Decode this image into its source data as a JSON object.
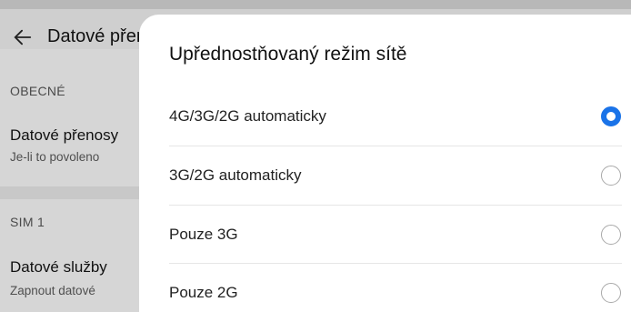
{
  "background": {
    "title": "Datové přenosy",
    "sections": [
      {
        "header": "OBECNÉ",
        "item_title": "Datové přenosy",
        "item_subtitle": "Je-li to povoleno"
      },
      {
        "header": "SIM 1",
        "item_title": "Datové služby",
        "item_subtitle": "Zapnout datové"
      }
    ]
  },
  "dialog": {
    "title": "Upřednostňovaný režim sítě",
    "options": [
      {
        "label": "4G/3G/2G automaticky",
        "selected": true
      },
      {
        "label": "3G/2G automaticky",
        "selected": false
      },
      {
        "label": "Pouze 3G",
        "selected": false
      },
      {
        "label": "Pouze 2G",
        "selected": false
      }
    ]
  },
  "colors": {
    "accent": "#1a73e8",
    "scrim": "#d6d6d6"
  },
  "icons": {
    "back": "arrow-left-icon"
  }
}
